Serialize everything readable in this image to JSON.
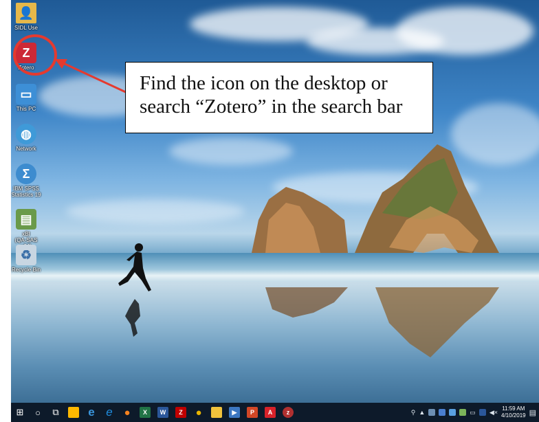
{
  "desktop_icons": [
    {
      "label": "SIDL Use",
      "icon": "user-folder-icon",
      "color": "#e6b84a"
    },
    {
      "label": "Zotero",
      "icon": "zotero-icon",
      "color": "#cc2936"
    },
    {
      "label": "This PC",
      "icon": "computer-icon",
      "color": "#3d8fd6"
    },
    {
      "label": "Network",
      "icon": "network-icon",
      "color": "#3f9ad8"
    },
    {
      "label": "IBM SPSS\nStatistics 19",
      "icon": "spss-icon",
      "color": "#3d8ccf"
    },
    {
      "label": "xBI\n(QA-SAS x64)",
      "icon": "app-shortcut-icon",
      "color": "#6a9a4a"
    },
    {
      "label": "Recycle Bin",
      "icon": "recycle-bin-icon",
      "color": "#c8d6e2"
    }
  ],
  "callout": {
    "line1": "Find the icon on the desktop or",
    "line2": "search “Zotero” in the search bar"
  },
  "taskbar": {
    "apps": [
      {
        "name": "start-button",
        "glyph": "⊞",
        "color": "#ffffff"
      },
      {
        "name": "search-button",
        "glyph": "○",
        "color": "#ffffff"
      },
      {
        "name": "task-view-button",
        "glyph": "⧉",
        "color": "#ffffff"
      },
      {
        "name": "store-app",
        "glyph": "🛍",
        "color": "#ffb900"
      },
      {
        "name": "edge-app",
        "glyph": "e",
        "color": "#3a96dd"
      },
      {
        "name": "ie-app",
        "glyph": "e",
        "color": "#1f8de0"
      },
      {
        "name": "firefox-app",
        "glyph": "●",
        "color": "#f5821f"
      },
      {
        "name": "excel-app",
        "glyph": "X",
        "color": "#217346"
      },
      {
        "name": "word-app",
        "glyph": "W",
        "color": "#2b579a"
      },
      {
        "name": "filezilla-app",
        "glyph": "Z",
        "color": "#bf0000"
      },
      {
        "name": "chrome-app",
        "glyph": "●",
        "color": "#e8b400"
      },
      {
        "name": "explorer-app",
        "glyph": "▬",
        "color": "#f0c23c"
      },
      {
        "name": "media-app",
        "glyph": "▶",
        "color": "#3c77c1"
      },
      {
        "name": "powerpoint-app",
        "glyph": "P",
        "color": "#d24726"
      },
      {
        "name": "acrobat-app",
        "glyph": "A",
        "color": "#d8222a"
      },
      {
        "name": "zotero-taskbar-app",
        "glyph": "z",
        "color": "#b03030"
      }
    ],
    "tray": {
      "time": "11:59 AM",
      "date": "4/10/2019",
      "volume_glyph": "◀×"
    }
  }
}
